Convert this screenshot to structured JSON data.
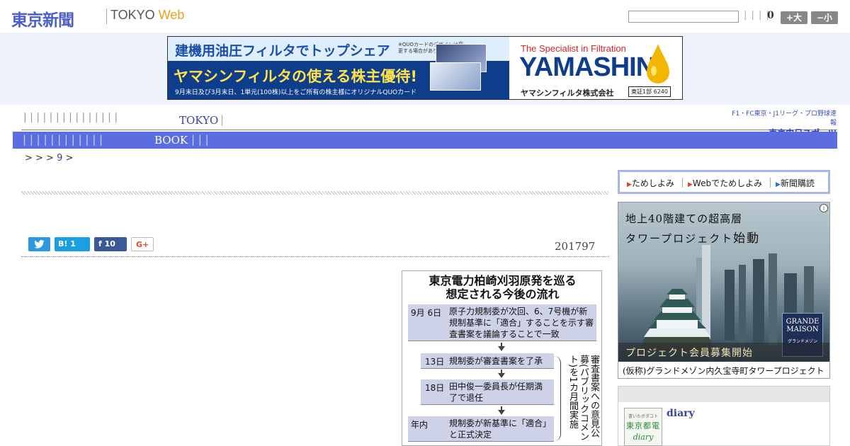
{
  "header": {
    "logo": "東京新聞",
    "site_tokyo": "TOKYO",
    "site_web": "Web",
    "nav_pipes": "| | | |",
    "count": "0",
    "font_up": "+大",
    "font_down": "−小"
  },
  "ad_banner": {
    "headline": "建機用油圧フィルタでトップシェア",
    "quo_note": "※QUOカードのデザインは変更する場合があります",
    "main": "ヤマシンフィルタの使える株主優待!",
    "sub": "9月末日及び3月末日、1単元(100株)以上をご所有の株主様にオリジナルQUOカード",
    "specialist": "The Specialist in Filtration",
    "brand": "YAMASHIN",
    "company": "ヤマシンフィルタ株式会社",
    "code": "東証1部 6240"
  },
  "nav": {
    "pipes": "| | | | | | | | | | | | | | |",
    "tokyo": "TOKYO",
    "tokyo_pipe": "|",
    "sub_pipes": "| | | | | | | | | | | |",
    "book": "BOOK",
    "sub_pipes2": "| | |",
    "chunichi_top": "F1・FC東京・J1リーグ・プロ野球速報",
    "chunichi_main": "東京中日スポーツ"
  },
  "breadcrumb": {
    "pre": "> > >",
    "item": "9",
    "post": ">"
  },
  "article": {
    "date": "201797",
    "share_twitter": "",
    "share_hatena": "B! 1",
    "share_facebook": "f  10",
    "share_gplus": "G+"
  },
  "figure": {
    "title_line1": "東京電力柏崎刈羽原発を巡る",
    "title_line2": "想定される今後の流れ",
    "row1_date": "9月 6日",
    "row1_text": "原子力規制委が次回、6、7号機が新規制基準に「適合」することを示す審査書案を議論することで一致",
    "row2_date": "13日",
    "row2_text": "規制委が審査書案を了承",
    "row3_date": "18日",
    "row3_text": "田中俊一委員長が任期満了で退任",
    "row4_date": "年内",
    "row4_text": "規制委が新基準に「適合」と正式決定",
    "vertical": "審査書案への意見公募(パブリックコメント)を1カ月間実施"
  },
  "sidebar": {
    "link1": "ためしよみ",
    "link2": "Webでためしよみ",
    "link3": "新聞購読",
    "ad_line1": "地上40階建ての超高層",
    "ad_line2a": "タワープロジェクト",
    "ad_line2b": "始動",
    "ad_bar": "プロジェクト会員募集開始",
    "ad_bottom": "(仮称)グランドメゾン内久宝寺町タワープロジェクト",
    "ad_brand_1": "GRANDE",
    "ad_brand_2": "MAISON",
    "ad_brand_small": "グランドメゾン",
    "ad_info": "i",
    "diary_thumb_top": "書いたボダコト",
    "diary_thumb_mid": "東京都電",
    "diary_thumb_bottom": "diary",
    "diary_link": "diary"
  },
  "colors": {
    "brand_blue": "#4a5fc8",
    "nav_bar": "#5b6de0",
    "ad_strip": "#eef2fb",
    "accent_orange": "#e8a21a"
  }
}
